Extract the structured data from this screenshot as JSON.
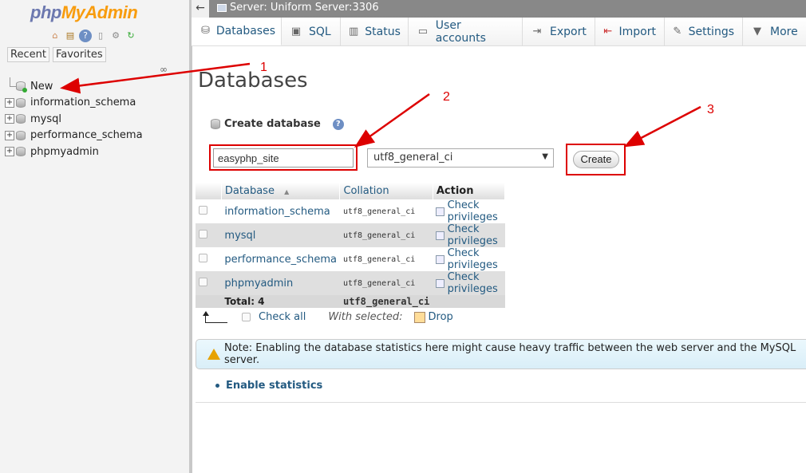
{
  "nav": {
    "logo_php": "php",
    "logo_my": "My",
    "logo_admin": "Admin",
    "tabs": [
      "Recent",
      "Favorites"
    ],
    "tree": [
      {
        "label": "New"
      },
      {
        "label": "information_schema"
      },
      {
        "label": "mysql"
      },
      {
        "label": "performance_schema"
      },
      {
        "label": "phpmyadmin"
      }
    ]
  },
  "topbar": {
    "back": "←",
    "server": "Server: Uniform Server:3306"
  },
  "menu": {
    "tabs": [
      {
        "label": "Databases",
        "icon": "database-icon"
      },
      {
        "label": "SQL",
        "icon": "sql-icon"
      },
      {
        "label": "Status",
        "icon": "status-icon"
      },
      {
        "label": "User accounts",
        "icon": "users-icon"
      },
      {
        "label": "Export",
        "icon": "export-icon"
      },
      {
        "label": "Import",
        "icon": "import-icon"
      },
      {
        "label": "Settings",
        "icon": "wrench-icon"
      },
      {
        "label": "More",
        "icon": "chevron-down-icon"
      }
    ]
  },
  "main": {
    "title": "Databases",
    "create_label": "Create database",
    "db_name_value": "easyphp_site",
    "collation": "utf8_general_ci",
    "create_button": "Create",
    "table": {
      "headers": [
        "Database",
        "Collation",
        "Action"
      ],
      "sort_mark": "▲",
      "rows": [
        {
          "name": "information_schema",
          "collation": "utf8_general_ci",
          "action": "Check privileges"
        },
        {
          "name": "mysql",
          "collation": "utf8_general_ci",
          "action": "Check privileges"
        },
        {
          "name": "performance_schema",
          "collation": "utf8_general_ci",
          "action": "Check privileges"
        },
        {
          "name": "phpmyadmin",
          "collation": "utf8_general_ci",
          "action": "Check privileges"
        }
      ],
      "total_label": "Total: 4",
      "total_collation": "utf8_general_ci"
    },
    "check_all": "Check all",
    "with_selected": "With selected:",
    "drop": "Drop",
    "notice": "Note: Enabling the database statistics here might cause heavy traffic between the web server and the MySQL server.",
    "enable_statistics": "Enable statistics"
  },
  "annotations": {
    "n1": "1",
    "n2": "2",
    "n3": "3",
    "color": "#dd0000"
  },
  "colors": {
    "link": "#235a81",
    "accent_orange": "#f89c0e",
    "logo_blue": "#6c78af"
  }
}
